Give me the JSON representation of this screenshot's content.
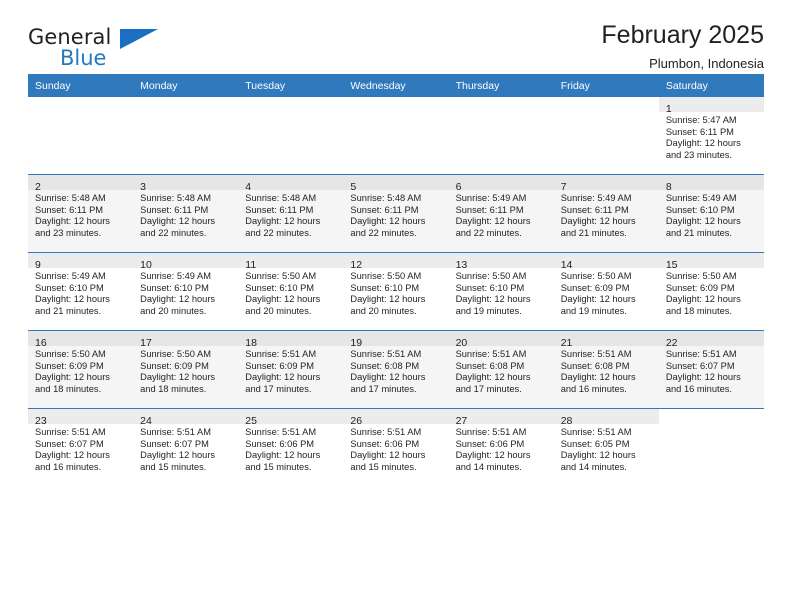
{
  "brand": {
    "name_top": "General",
    "name_bottom": "Blue",
    "triangle_color": "#1b6ec0",
    "blue_color": "#2679bd"
  },
  "header": {
    "title": "February 2025",
    "subtitle": "Plumbon, Indonesia"
  },
  "theme": {
    "header_bg": "#3179bd",
    "header_text": "#ffffff",
    "daynum_strip": "#ececec",
    "alt_row_bg": "#f5f5f5"
  },
  "weekdays": [
    "Sunday",
    "Monday",
    "Tuesday",
    "Wednesday",
    "Thursday",
    "Friday",
    "Saturday"
  ],
  "weeks": [
    [
      {
        "day": "",
        "sunrise": "",
        "sunset": "",
        "daylight1": "",
        "daylight2": ""
      },
      {
        "day": "",
        "sunrise": "",
        "sunset": "",
        "daylight1": "",
        "daylight2": ""
      },
      {
        "day": "",
        "sunrise": "",
        "sunset": "",
        "daylight1": "",
        "daylight2": ""
      },
      {
        "day": "",
        "sunrise": "",
        "sunset": "",
        "daylight1": "",
        "daylight2": ""
      },
      {
        "day": "",
        "sunrise": "",
        "sunset": "",
        "daylight1": "",
        "daylight2": ""
      },
      {
        "day": "",
        "sunrise": "",
        "sunset": "",
        "daylight1": "",
        "daylight2": ""
      },
      {
        "day": "1",
        "sunrise": "Sunrise: 5:47 AM",
        "sunset": "Sunset: 6:11 PM",
        "daylight1": "Daylight: 12 hours",
        "daylight2": "and 23 minutes."
      }
    ],
    [
      {
        "day": "2",
        "sunrise": "Sunrise: 5:48 AM",
        "sunset": "Sunset: 6:11 PM",
        "daylight1": "Daylight: 12 hours",
        "daylight2": "and 23 minutes."
      },
      {
        "day": "3",
        "sunrise": "Sunrise: 5:48 AM",
        "sunset": "Sunset: 6:11 PM",
        "daylight1": "Daylight: 12 hours",
        "daylight2": "and 22 minutes."
      },
      {
        "day": "4",
        "sunrise": "Sunrise: 5:48 AM",
        "sunset": "Sunset: 6:11 PM",
        "daylight1": "Daylight: 12 hours",
        "daylight2": "and 22 minutes."
      },
      {
        "day": "5",
        "sunrise": "Sunrise: 5:48 AM",
        "sunset": "Sunset: 6:11 PM",
        "daylight1": "Daylight: 12 hours",
        "daylight2": "and 22 minutes."
      },
      {
        "day": "6",
        "sunrise": "Sunrise: 5:49 AM",
        "sunset": "Sunset: 6:11 PM",
        "daylight1": "Daylight: 12 hours",
        "daylight2": "and 22 minutes."
      },
      {
        "day": "7",
        "sunrise": "Sunrise: 5:49 AM",
        "sunset": "Sunset: 6:11 PM",
        "daylight1": "Daylight: 12 hours",
        "daylight2": "and 21 minutes."
      },
      {
        "day": "8",
        "sunrise": "Sunrise: 5:49 AM",
        "sunset": "Sunset: 6:10 PM",
        "daylight1": "Daylight: 12 hours",
        "daylight2": "and 21 minutes."
      }
    ],
    [
      {
        "day": "9",
        "sunrise": "Sunrise: 5:49 AM",
        "sunset": "Sunset: 6:10 PM",
        "daylight1": "Daylight: 12 hours",
        "daylight2": "and 21 minutes."
      },
      {
        "day": "10",
        "sunrise": "Sunrise: 5:49 AM",
        "sunset": "Sunset: 6:10 PM",
        "daylight1": "Daylight: 12 hours",
        "daylight2": "and 20 minutes."
      },
      {
        "day": "11",
        "sunrise": "Sunrise: 5:50 AM",
        "sunset": "Sunset: 6:10 PM",
        "daylight1": "Daylight: 12 hours",
        "daylight2": "and 20 minutes."
      },
      {
        "day": "12",
        "sunrise": "Sunrise: 5:50 AM",
        "sunset": "Sunset: 6:10 PM",
        "daylight1": "Daylight: 12 hours",
        "daylight2": "and 20 minutes."
      },
      {
        "day": "13",
        "sunrise": "Sunrise: 5:50 AM",
        "sunset": "Sunset: 6:10 PM",
        "daylight1": "Daylight: 12 hours",
        "daylight2": "and 19 minutes."
      },
      {
        "day": "14",
        "sunrise": "Sunrise: 5:50 AM",
        "sunset": "Sunset: 6:09 PM",
        "daylight1": "Daylight: 12 hours",
        "daylight2": "and 19 minutes."
      },
      {
        "day": "15",
        "sunrise": "Sunrise: 5:50 AM",
        "sunset": "Sunset: 6:09 PM",
        "daylight1": "Daylight: 12 hours",
        "daylight2": "and 18 minutes."
      }
    ],
    [
      {
        "day": "16",
        "sunrise": "Sunrise: 5:50 AM",
        "sunset": "Sunset: 6:09 PM",
        "daylight1": "Daylight: 12 hours",
        "daylight2": "and 18 minutes."
      },
      {
        "day": "17",
        "sunrise": "Sunrise: 5:50 AM",
        "sunset": "Sunset: 6:09 PM",
        "daylight1": "Daylight: 12 hours",
        "daylight2": "and 18 minutes."
      },
      {
        "day": "18",
        "sunrise": "Sunrise: 5:51 AM",
        "sunset": "Sunset: 6:09 PM",
        "daylight1": "Daylight: 12 hours",
        "daylight2": "and 17 minutes."
      },
      {
        "day": "19",
        "sunrise": "Sunrise: 5:51 AM",
        "sunset": "Sunset: 6:08 PM",
        "daylight1": "Daylight: 12 hours",
        "daylight2": "and 17 minutes."
      },
      {
        "day": "20",
        "sunrise": "Sunrise: 5:51 AM",
        "sunset": "Sunset: 6:08 PM",
        "daylight1": "Daylight: 12 hours",
        "daylight2": "and 17 minutes."
      },
      {
        "day": "21",
        "sunrise": "Sunrise: 5:51 AM",
        "sunset": "Sunset: 6:08 PM",
        "daylight1": "Daylight: 12 hours",
        "daylight2": "and 16 minutes."
      },
      {
        "day": "22",
        "sunrise": "Sunrise: 5:51 AM",
        "sunset": "Sunset: 6:07 PM",
        "daylight1": "Daylight: 12 hours",
        "daylight2": "and 16 minutes."
      }
    ],
    [
      {
        "day": "23",
        "sunrise": "Sunrise: 5:51 AM",
        "sunset": "Sunset: 6:07 PM",
        "daylight1": "Daylight: 12 hours",
        "daylight2": "and 16 minutes."
      },
      {
        "day": "24",
        "sunrise": "Sunrise: 5:51 AM",
        "sunset": "Sunset: 6:07 PM",
        "daylight1": "Daylight: 12 hours",
        "daylight2": "and 15 minutes."
      },
      {
        "day": "25",
        "sunrise": "Sunrise: 5:51 AM",
        "sunset": "Sunset: 6:06 PM",
        "daylight1": "Daylight: 12 hours",
        "daylight2": "and 15 minutes."
      },
      {
        "day": "26",
        "sunrise": "Sunrise: 5:51 AM",
        "sunset": "Sunset: 6:06 PM",
        "daylight1": "Daylight: 12 hours",
        "daylight2": "and 15 minutes."
      },
      {
        "day": "27",
        "sunrise": "Sunrise: 5:51 AM",
        "sunset": "Sunset: 6:06 PM",
        "daylight1": "Daylight: 12 hours",
        "daylight2": "and 14 minutes."
      },
      {
        "day": "28",
        "sunrise": "Sunrise: 5:51 AM",
        "sunset": "Sunset: 6:05 PM",
        "daylight1": "Daylight: 12 hours",
        "daylight2": "and 14 minutes."
      },
      {
        "day": "",
        "sunrise": "",
        "sunset": "",
        "daylight1": "",
        "daylight2": ""
      }
    ]
  ]
}
